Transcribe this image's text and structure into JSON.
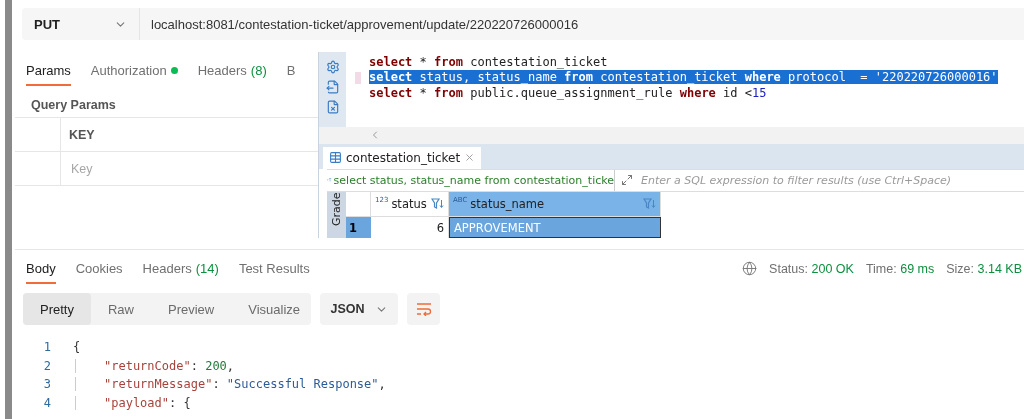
{
  "request": {
    "method": "PUT",
    "url": "localhost:8081/contestation-ticket/approvement/update/220220726000016"
  },
  "request_tabs": [
    {
      "label": "Params",
      "selected": true,
      "status_dot": false
    },
    {
      "label": "Authorization",
      "selected": false,
      "status_dot": true
    },
    {
      "label": "Headers",
      "count": "(8)",
      "selected": false,
      "status_dot": false
    },
    {
      "label": "B",
      "selected": false,
      "status_dot": false
    }
  ],
  "query_params": {
    "title": "Query Params",
    "column": "KEY",
    "placeholder": "Key"
  },
  "response_tabs": [
    {
      "label": "Body",
      "selected": true
    },
    {
      "label": "Cookies",
      "selected": false
    },
    {
      "label": "Headers",
      "count": "(14)",
      "selected": false
    },
    {
      "label": "Test Results",
      "selected": false
    }
  ],
  "response_meta": [
    {
      "label": "Status:",
      "value": "200 OK"
    },
    {
      "label": "Time:",
      "value": "69 ms"
    },
    {
      "label": "Size:",
      "value": "3.14 KB"
    }
  ],
  "view_modes": [
    {
      "label": "Pretty",
      "selected": true
    },
    {
      "label": "Raw",
      "selected": false
    },
    {
      "label": "Preview",
      "selected": false
    },
    {
      "label": "Visualize",
      "selected": false
    }
  ],
  "format": "JSON",
  "code_lines": [
    {
      "number": "1",
      "tokens": [
        {
          "kind": "punct",
          "text": "{"
        }
      ],
      "indent": false
    },
    {
      "number": "2",
      "indent": true,
      "tokens": [
        {
          "kind": "key",
          "text": "\"returnCode\""
        },
        {
          "kind": "punct",
          "text": ": "
        },
        {
          "kind": "number",
          "text": "200"
        },
        {
          "kind": "punct",
          "text": ","
        }
      ]
    },
    {
      "number": "3",
      "indent": true,
      "tokens": [
        {
          "kind": "key",
          "text": "\"returnMessage\""
        },
        {
          "kind": "punct",
          "text": ": "
        },
        {
          "kind": "string",
          "text": "\"Successful Response\""
        },
        {
          "kind": "punct",
          "text": ","
        }
      ]
    },
    {
      "number": "4",
      "indent": true,
      "tokens": [
        {
          "kind": "key",
          "text": "\"payload\""
        },
        {
          "kind": "punct",
          "text": ": "
        },
        {
          "kind": "punct",
          "text": "{"
        }
      ]
    }
  ],
  "sql_editor": {
    "lines": [
      {
        "selected": false,
        "tokens": [
          {
            "kind": "keyword",
            "text": "select"
          },
          {
            "kind": "plain",
            "text": " * "
          },
          {
            "kind": "keyword",
            "text": "from"
          },
          {
            "kind": "plain",
            "text": " contestation_ticket"
          }
        ]
      },
      {
        "selected": true,
        "tokens": [
          {
            "kind": "keyword",
            "text": "select"
          },
          {
            "kind": "plain",
            "text": " status, status_name "
          },
          {
            "kind": "keyword",
            "text": "from"
          },
          {
            "kind": "plain",
            "text": " contestation_ticket "
          },
          {
            "kind": "keyword",
            "text": "where"
          },
          {
            "kind": "plain",
            "text": " protocol  = '220220726000016'"
          }
        ]
      },
      {
        "selected": false,
        "tokens": [
          {
            "kind": "keyword",
            "text": "select"
          },
          {
            "kind": "plain",
            "text": " * "
          },
          {
            "kind": "keyword",
            "text": "from"
          },
          {
            "kind": "plain",
            "text": " public.queue_assignment_rule "
          },
          {
            "kind": "keyword",
            "text": "where"
          },
          {
            "kind": "plain",
            "text": " id <"
          },
          {
            "kind": "number",
            "text": "15"
          }
        ]
      }
    ]
  },
  "results": {
    "tab": "contestation_ticket",
    "query": "select status, status_name from contestation_ticke",
    "filter_placeholder": "Enter a SQL expression to filter results (use Ctrl+Space)",
    "side_tab": "Grade",
    "columns": [
      {
        "type_label": "123",
        "name": "status",
        "kind": "number",
        "selected": false
      },
      {
        "type_label": "ABC",
        "name": "status_name",
        "kind": "text",
        "selected": true
      }
    ],
    "rows": [
      {
        "number": "1",
        "cells": [
          "6",
          "APPROVEMENT"
        ],
        "selected": true
      }
    ]
  }
}
